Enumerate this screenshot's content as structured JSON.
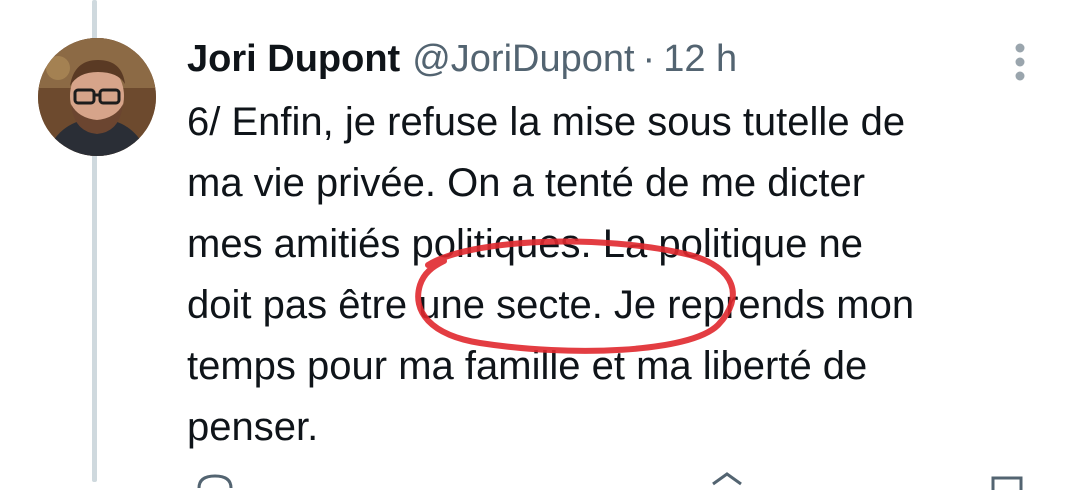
{
  "tweet": {
    "author": {
      "display_name": "Jori Dupont",
      "handle": "@JoriDupont"
    },
    "separator": "·",
    "time": "12 h",
    "text_lines": [
      "6/ Enfin, je refuse la mise sous tutelle de",
      "ma vie privée. On a tenté de me dicter",
      "mes amitiés politiques. La politique ne",
      "doit pas être une secte. Je reprends mon",
      "temps pour ma famille et ma liberté de",
      "penser."
    ]
  },
  "icons": {
    "more": "more-vertical-icon",
    "annotation": "red-circle-annotation",
    "actions": [
      "reply-icon",
      "retweet-icon",
      "share-icon"
    ]
  },
  "colors": {
    "text": "#0f1419",
    "muted": "#536471",
    "thread_line": "#cfd9de",
    "annotation_red": "#e0282e"
  }
}
